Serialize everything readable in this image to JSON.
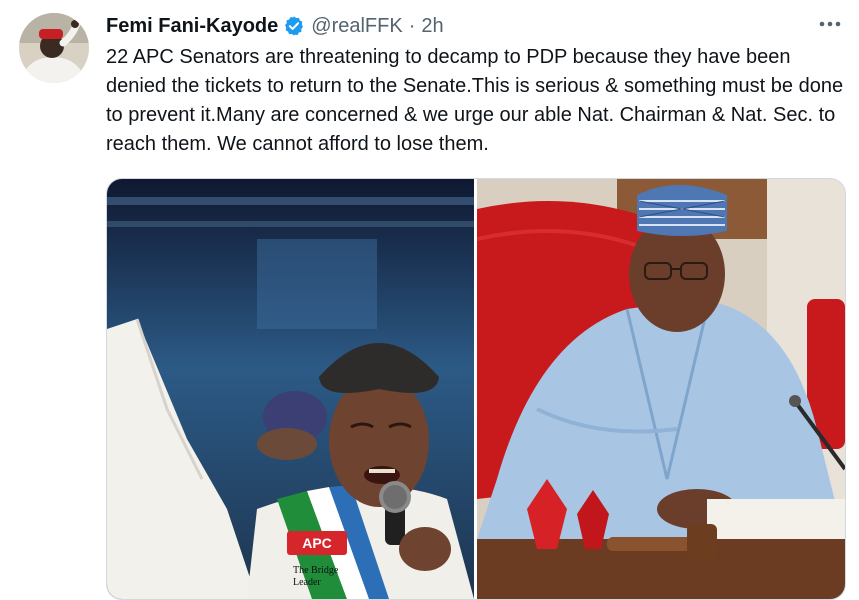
{
  "tweet": {
    "author_name": "Femi Fani-Kayode",
    "handle": "@realFFK",
    "separator": "·",
    "time": "2h",
    "verified": true,
    "text": "22 APC Senators are threatening to decamp to PDP because they have been denied the tickets to return to the Senate.This is serious & something must be done to prevent it.Many are concerned & we urge our able Nat. Chairman & Nat. Sec. to reach them. We cannot afford to lose them."
  },
  "media": {
    "count": 2,
    "left_photo_text": {
      "party": "APC",
      "slogan_line1": "The Bridge",
      "slogan_line2": "Leader"
    }
  },
  "icons": {
    "more": "more-icon",
    "verified": "verified-badge-icon"
  },
  "colors": {
    "verified_blue": "#1d9bf0",
    "secondary_text": "#536471",
    "text": "#0f1419",
    "chair_red": "#c8191c",
    "stage_blue": "#2c5a86"
  }
}
